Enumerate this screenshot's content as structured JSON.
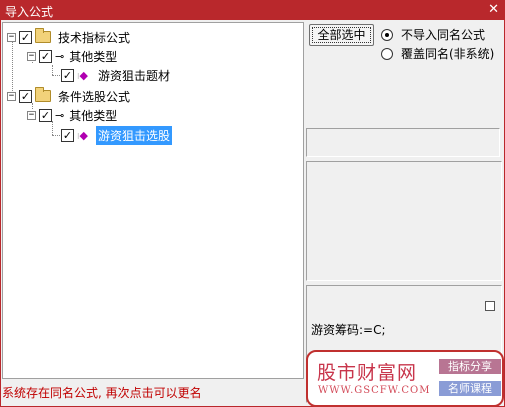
{
  "window": {
    "title": "导入公式",
    "close_glyph": "✕"
  },
  "tree": {
    "nodes": [
      {
        "label": "技术指标公式",
        "checked": true,
        "expand": "−"
      },
      {
        "label": "其他类型",
        "checked": true,
        "expand": "−"
      },
      {
        "label": "游资狙击题材",
        "checked": true
      },
      {
        "label": "条件选股公式",
        "checked": true,
        "expand": "−"
      },
      {
        "label": "其他类型",
        "checked": true,
        "expand": "−"
      },
      {
        "label": "游资狙击选股",
        "checked": true,
        "selected": true
      }
    ]
  },
  "options": {
    "select_all_label": "全部选中",
    "radio_no_import": "不导入同名公式",
    "radio_overwrite": "覆盖同名(非系统)",
    "selected_radio": "no_import"
  },
  "detail": {
    "code_text": "游资筹码:=C;"
  },
  "status_text": "系统存在同名公式, 再次点击可以更名",
  "watermark": {
    "brand": "股市财富网",
    "url": "WWW.GSCFW.COM",
    "tag1": "指标分享",
    "tag2": "名师课程"
  },
  "colors": {
    "titlebar": "#b9282c",
    "selection": "#3399ff",
    "status": "#c00000"
  }
}
